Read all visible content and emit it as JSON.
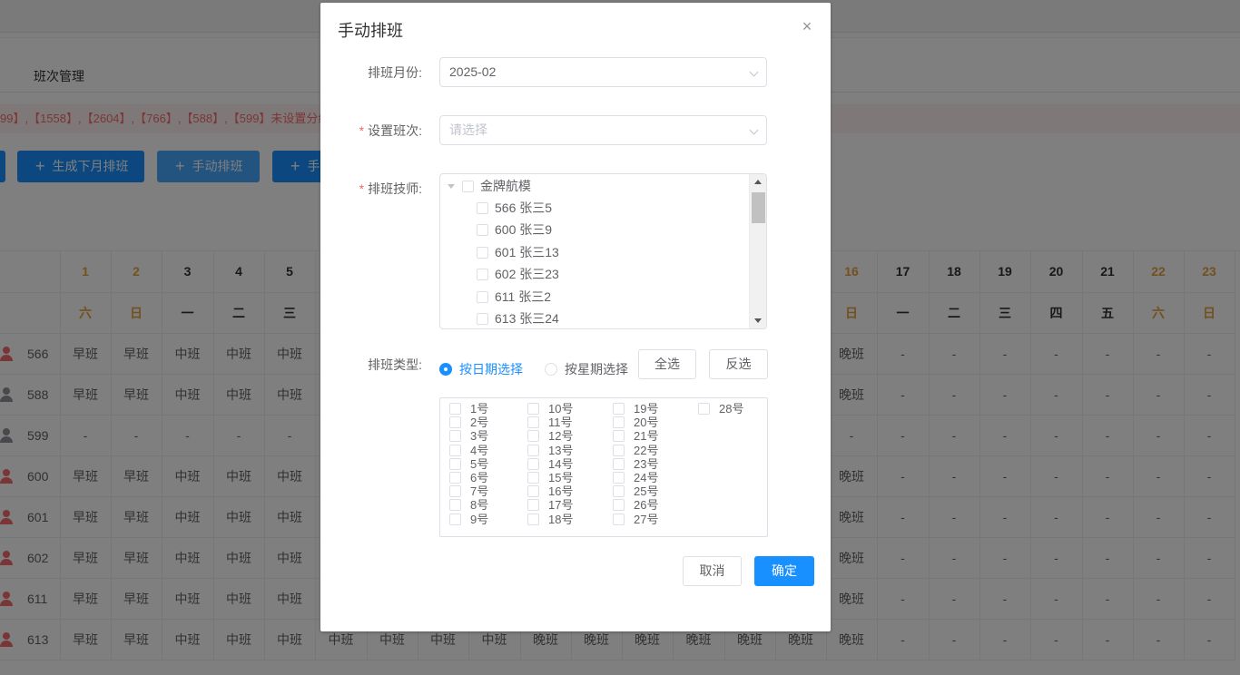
{
  "background": {
    "tab": "班次管理",
    "alert": "99】,【1558】,【2604】,【766】,【588】,【599】未设置分组",
    "buttons": {
      "generate_next": "生成下月排班",
      "manual": "手动排班",
      "partial": "手"
    },
    "columns": [
      {
        "day": "1",
        "weekday": "六",
        "weekend": true
      },
      {
        "day": "2",
        "weekday": "日",
        "weekend": true
      },
      {
        "day": "3",
        "weekday": "一",
        "weekend": false
      },
      {
        "day": "4",
        "weekday": "二",
        "weekend": false
      },
      {
        "day": "5",
        "weekday": "三",
        "weekend": false
      },
      {
        "day": "",
        "weekday": "",
        "weekend": false
      },
      {
        "day": "",
        "weekday": "",
        "weekend": false
      },
      {
        "day": "",
        "weekday": "",
        "weekend": false
      },
      {
        "day": "",
        "weekday": "",
        "weekend": false
      },
      {
        "day": "",
        "weekday": "",
        "weekend": false
      },
      {
        "day": "",
        "weekday": "",
        "weekend": false
      },
      {
        "day": "",
        "weekday": "",
        "weekend": false
      },
      {
        "day": "",
        "weekday": "",
        "weekend": false
      },
      {
        "day": "",
        "weekday": "",
        "weekend": false
      },
      {
        "day": "",
        "weekday": "",
        "weekend": false
      },
      {
        "day": "16",
        "weekday": "日",
        "weekend": true
      },
      {
        "day": "17",
        "weekday": "一",
        "weekend": false
      },
      {
        "day": "18",
        "weekday": "二",
        "weekend": false
      },
      {
        "day": "19",
        "weekday": "三",
        "weekend": false
      },
      {
        "day": "20",
        "weekday": "四",
        "weekend": false
      },
      {
        "day": "21",
        "weekday": "五",
        "weekend": false
      },
      {
        "day": "22",
        "weekday": "六",
        "weekend": true
      },
      {
        "day": "23",
        "weekday": "日",
        "weekend": true
      }
    ],
    "rows": [
      {
        "id": "566",
        "icon": "red",
        "cells": [
          "早班",
          "早班",
          "中班",
          "中班",
          "中班",
          "",
          "",
          "",
          "",
          "",
          "",
          "",
          "",
          "",
          "",
          "晚班",
          "-",
          "-",
          "-",
          "-",
          "-",
          "-",
          "-"
        ]
      },
      {
        "id": "588",
        "icon": "grey",
        "cells": [
          "早班",
          "早班",
          "中班",
          "中班",
          "中班",
          "",
          "",
          "",
          "",
          "",
          "",
          "",
          "",
          "",
          "",
          "晚班",
          "-",
          "-",
          "-",
          "-",
          "-",
          "-",
          "-"
        ]
      },
      {
        "id": "599",
        "icon": "grey",
        "cells": [
          "-",
          "-",
          "-",
          "-",
          "-",
          "",
          "",
          "",
          "",
          "",
          "",
          "",
          "",
          "",
          "",
          "-",
          "-",
          "-",
          "-",
          "-",
          "-",
          "-",
          "-"
        ]
      },
      {
        "id": "600",
        "icon": "red",
        "cells": [
          "早班",
          "早班",
          "中班",
          "中班",
          "中班",
          "",
          "",
          "",
          "",
          "",
          "",
          "",
          "",
          "",
          "",
          "晚班",
          "-",
          "-",
          "-",
          "-",
          "-",
          "-",
          "-"
        ]
      },
      {
        "id": "601",
        "icon": "red",
        "cells": [
          "早班",
          "早班",
          "中班",
          "中班",
          "中班",
          "",
          "",
          "",
          "",
          "",
          "",
          "",
          "",
          "",
          "",
          "晚班",
          "-",
          "-",
          "-",
          "-",
          "-",
          "-",
          "-"
        ]
      },
      {
        "id": "602",
        "icon": "red",
        "cells": [
          "早班",
          "早班",
          "中班",
          "中班",
          "中班",
          "",
          "",
          "",
          "",
          "",
          "",
          "",
          "",
          "",
          "",
          "晚班",
          "-",
          "-",
          "-",
          "-",
          "-",
          "-",
          "-"
        ]
      },
      {
        "id": "611",
        "icon": "red",
        "cells": [
          "早班",
          "早班",
          "中班",
          "中班",
          "中班",
          "",
          "",
          "",
          "",
          "",
          "",
          "",
          "",
          "",
          "",
          "晚班",
          "-",
          "-",
          "-",
          "-",
          "-",
          "-",
          "-"
        ]
      },
      {
        "id": "613",
        "icon": "red",
        "cells": [
          "早班",
          "早班",
          "中班",
          "中班",
          "中班",
          "中班",
          "中班",
          "中班",
          "中班",
          "晚班",
          "晚班",
          "晚班",
          "晚班",
          "晚班",
          "晚班",
          "晚班",
          "-",
          "-",
          "-",
          "-",
          "-",
          "-",
          "-"
        ]
      }
    ]
  },
  "dialog": {
    "title": "手动排班",
    "close": "×",
    "month": {
      "label": "排班月份:",
      "value": "2025-02"
    },
    "shift": {
      "label": "设置班次:",
      "placeholder": "请选择"
    },
    "techs": {
      "label": "排班技师:",
      "group": "金牌航模",
      "items": [
        "566 张三5",
        "600 张三9",
        "601 张三13",
        "602 张三23",
        "611 张三2",
        "613 张三24"
      ]
    },
    "type": {
      "label": "排班类型:",
      "by_date": "按日期选择",
      "by_week": "按星期选择",
      "select_all": "全选",
      "invert": "反选"
    },
    "days": [
      "1号",
      "2号",
      "3号",
      "4号",
      "5号",
      "6号",
      "7号",
      "8号",
      "9号",
      "10号",
      "11号",
      "12号",
      "13号",
      "14号",
      "15号",
      "16号",
      "17号",
      "18号",
      "19号",
      "20号",
      "21号",
      "22号",
      "23号",
      "24号",
      "25号",
      "26号",
      "27号",
      "28号"
    ],
    "cancel": "取消",
    "confirm": "确定"
  },
  "colors": {
    "primary": "#1890ff",
    "danger": "#f56c6c",
    "weekend": "#e6a23c"
  }
}
